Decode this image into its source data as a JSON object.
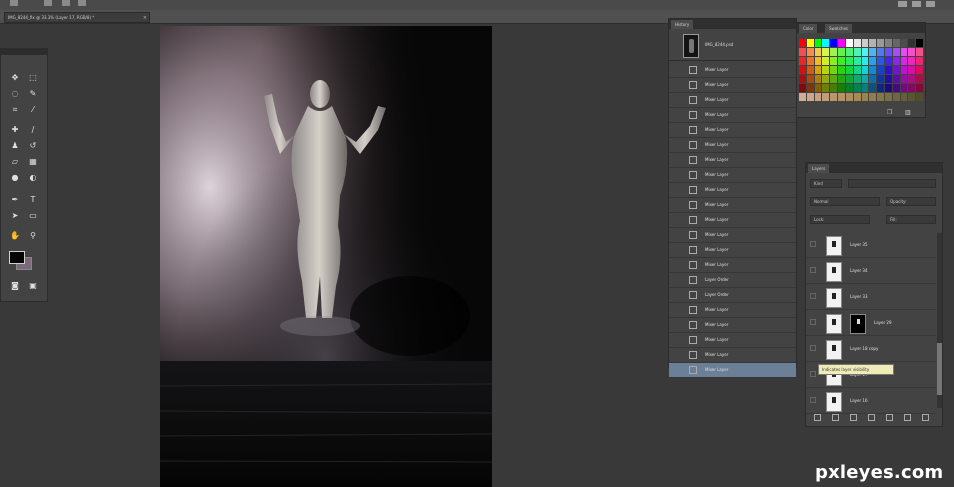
{
  "document": {
    "tab_title": "IMG_8244_fix @ 33.3% (Layer 17, RGB/8) *",
    "tab_close": "×"
  },
  "tools": {
    "items": [
      "move",
      "marquee",
      "lasso",
      "quick-select",
      "crop",
      "eyedropper",
      "heal",
      "brush",
      "stamp",
      "history-brush",
      "eraser",
      "gradient",
      "blur",
      "dodge",
      "pen",
      "type",
      "path-select",
      "shape",
      "hand",
      "zoom"
    ],
    "colors": {
      "foreground": "#050505",
      "background": "#7a6a7a"
    }
  },
  "history": {
    "tab": "History",
    "snapshot": "IMG_8244.psd",
    "items": [
      "Mixer Layer",
      "Mixer Layer",
      "Mixer Layer",
      "Mixer Layer",
      "Mixer Layer",
      "Mixer Layer",
      "Mixer Layer",
      "Mixer Layer",
      "Mixer Layer",
      "Mixer Layer",
      "Mixer Layer",
      "Mixer Layer",
      "Mixer Layer",
      "Mixer Layer",
      "Layer Order",
      "Layer Order",
      "Mixer Layer",
      "Mixer Layer",
      "Mixer Layer",
      "Mixer Layer",
      "Mixer Layer"
    ],
    "selected_index": 20
  },
  "swatches": {
    "tabs": [
      "Color",
      "Swatches"
    ],
    "footer_icons": [
      "new-swatch-icon",
      "trash-icon"
    ]
  },
  "layers": {
    "tab": "Layers",
    "kind_filter": "Kind",
    "blend_mode": "Normal",
    "opacity_label": "Opacity:",
    "lock_label": "Lock:",
    "fill_label": "Fill:",
    "rows": [
      {
        "name": "Layer 35",
        "mask": false
      },
      {
        "name": "Layer 34",
        "mask": false
      },
      {
        "name": "Layer 33",
        "mask": false
      },
      {
        "name": "Layer 29",
        "mask": true
      },
      {
        "name": "Layer 18 copy",
        "mask": false
      },
      {
        "name": "Layer 17",
        "mask": false
      },
      {
        "name": "Layer 16",
        "mask": false
      }
    ],
    "tooltip": "Indicates layer visibility"
  },
  "watermark": "pxleyes.com"
}
